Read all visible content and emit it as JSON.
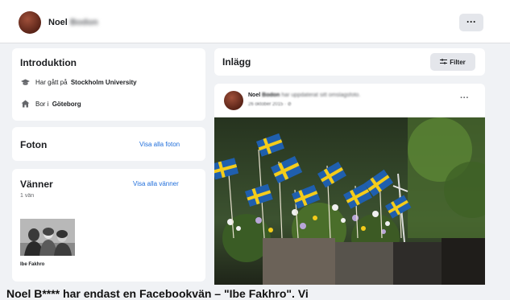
{
  "header": {
    "name": "Noel",
    "name_blurred": "Bodon",
    "more_label": "···"
  },
  "intro": {
    "title": "Introduktion",
    "studied_prefix": "Har gått på",
    "studied_place": "Stockholm University",
    "lives_prefix": "Bor i",
    "lives_place": "Göteborg"
  },
  "photos": {
    "title": "Foton",
    "link": "Visa alla foton"
  },
  "friends": {
    "title": "Vänner",
    "link": "Visa alla vänner",
    "count": "1 vän",
    "friend_name": "Ibe Fakhro"
  },
  "posts": {
    "title": "Inlägg",
    "filter_label": "Filter",
    "post": {
      "author": "Noel",
      "author_blurred": "Bodon",
      "action": "har uppdaterat sitt omslagsfoto.",
      "date": "26 oktober 2015 · ⊘",
      "more": "···"
    }
  },
  "caption": "Noel B**** har endast en Facebookvän – \"Ibe Fakhro\". Vi",
  "colors": {
    "link": "#216fdb",
    "flag_blue": "#1f5fae",
    "flag_yellow": "#f4cc1a"
  }
}
